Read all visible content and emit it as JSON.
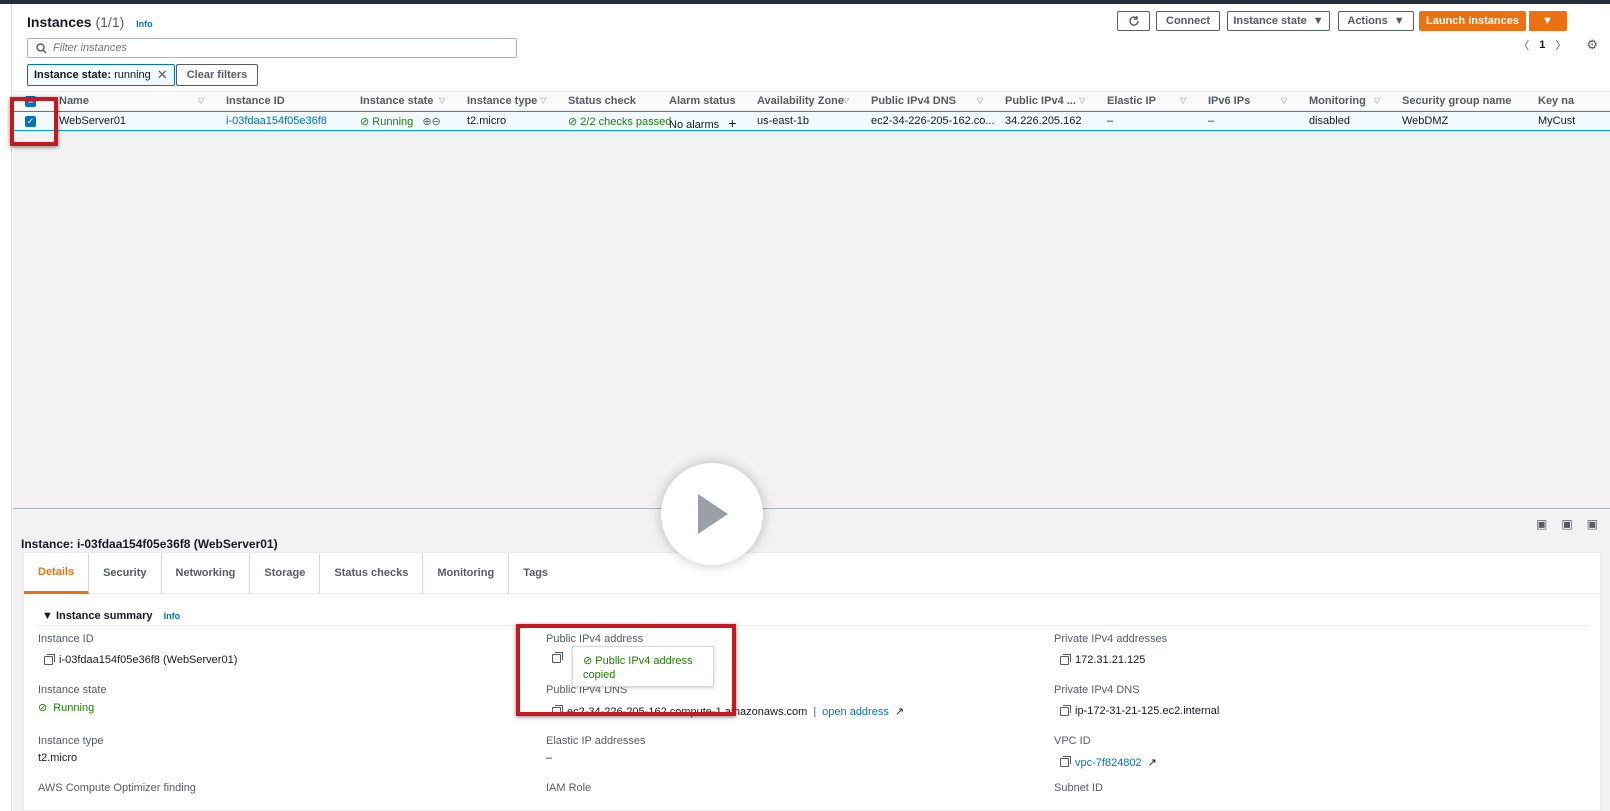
{
  "header": {
    "title": "Instances",
    "count": "(1/1)",
    "info": "Info",
    "buttons": {
      "refresh_icon": "refresh-icon",
      "connect": "Connect",
      "instance_state": "Instance state",
      "actions": "Actions",
      "launch": "Launch instances"
    },
    "search_placeholder": "Filter instances",
    "filter_chip_key": "Instance state:",
    "filter_chip_value": "running",
    "clear_filters": "Clear filters",
    "page": "1"
  },
  "table": {
    "columns": [
      "Name",
      "Instance ID",
      "Instance state",
      "Instance type",
      "Status check",
      "Alarm status",
      "Availability Zone",
      "Public IPv4 DNS",
      "Public IPv4 ...",
      "Elastic IP",
      "IPv6 IPs",
      "Monitoring",
      "Security group name",
      "Key na"
    ],
    "row": {
      "name": "WebServer01",
      "instance_id": "i-03fdaa154f05e36f8",
      "state": "Running",
      "type": "t2.micro",
      "status_check": "2/2 checks passed",
      "alarm": "No alarms",
      "az": "us-east-1b",
      "dns": "ec2-34-226-205-162.co...",
      "ipv4": "34.226.205.162",
      "elastic_ip": "–",
      "ipv6": "–",
      "monitoring": "disabled",
      "sg": "WebDMZ",
      "key": "MyCust"
    }
  },
  "details": {
    "panel_title": "Instance: i-03fdaa154f05e36f8 (WebServer01)",
    "tabs": [
      "Details",
      "Security",
      "Networking",
      "Storage",
      "Status checks",
      "Monitoring",
      "Tags"
    ],
    "summary_title": "Instance summary",
    "summary_info": "Info",
    "fields": {
      "instance_id_label": "Instance ID",
      "instance_id_value": "i-03fdaa154f05e36f8 (WebServer01)",
      "instance_state_label": "Instance state",
      "instance_state_value": "Running",
      "instance_type_label": "Instance type",
      "instance_type_value": "t2.micro",
      "optimizer_label": "AWS Compute Optimizer finding",
      "public_ipv4_label": "Public IPv4 address",
      "public_dns_label": "Public IPv4 DNS",
      "public_dns_value": "ec2-34-226-205-162.compute-1.amazonaws.com",
      "open_address": "open address",
      "elastic_label": "Elastic IP addresses",
      "elastic_value": "–",
      "iam_label": "IAM Role",
      "private_ipv4_label": "Private IPv4 addresses",
      "private_ipv4_value": "172.31.21.125",
      "private_dns_label": "Private IPv4 DNS",
      "private_dns_value": "ip-172-31-21-125.ec2.internal",
      "vpc_label": "VPC ID",
      "vpc_value": "vpc-7f824802",
      "subnet_label": "Subnet ID"
    },
    "tooltip_line1": "Public IPv4 address",
    "tooltip_line2": "copied"
  },
  "colors": {
    "accent": "#ec7211",
    "link": "#0073bb",
    "success": "#1d8102",
    "highlight": "#c7181f"
  }
}
